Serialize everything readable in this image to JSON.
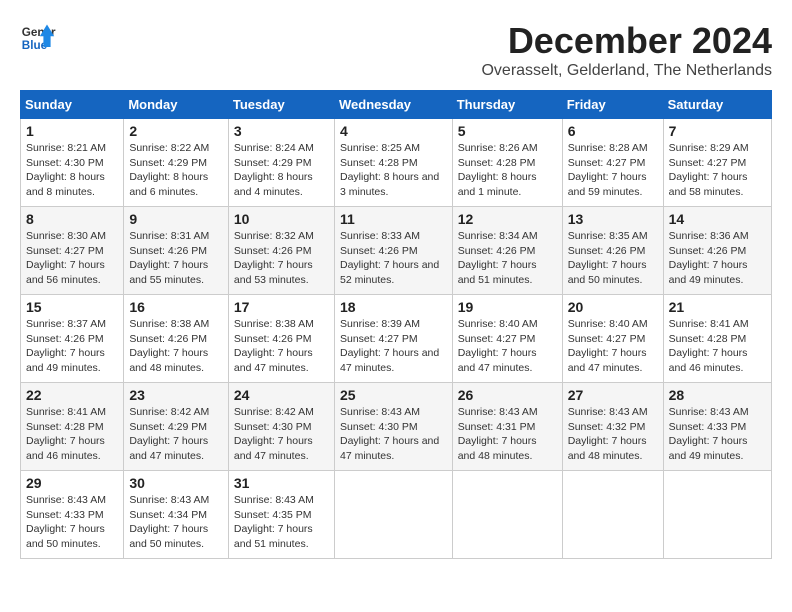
{
  "header": {
    "logo_line1": "General",
    "logo_line2": "Blue",
    "month": "December 2024",
    "location": "Overasselt, Gelderland, The Netherlands"
  },
  "days_of_week": [
    "Sunday",
    "Monday",
    "Tuesday",
    "Wednesday",
    "Thursday",
    "Friday",
    "Saturday"
  ],
  "weeks": [
    [
      {
        "day": "1",
        "sunrise": "8:21 AM",
        "sunset": "4:30 PM",
        "daylight": "8 hours and 8 minutes."
      },
      {
        "day": "2",
        "sunrise": "8:22 AM",
        "sunset": "4:29 PM",
        "daylight": "8 hours and 6 minutes."
      },
      {
        "day": "3",
        "sunrise": "8:24 AM",
        "sunset": "4:29 PM",
        "daylight": "8 hours and 4 minutes."
      },
      {
        "day": "4",
        "sunrise": "8:25 AM",
        "sunset": "4:28 PM",
        "daylight": "8 hours and 3 minutes."
      },
      {
        "day": "5",
        "sunrise": "8:26 AM",
        "sunset": "4:28 PM",
        "daylight": "8 hours and 1 minute."
      },
      {
        "day": "6",
        "sunrise": "8:28 AM",
        "sunset": "4:27 PM",
        "daylight": "7 hours and 59 minutes."
      },
      {
        "day": "7",
        "sunrise": "8:29 AM",
        "sunset": "4:27 PM",
        "daylight": "7 hours and 58 minutes."
      }
    ],
    [
      {
        "day": "8",
        "sunrise": "8:30 AM",
        "sunset": "4:27 PM",
        "daylight": "7 hours and 56 minutes."
      },
      {
        "day": "9",
        "sunrise": "8:31 AM",
        "sunset": "4:26 PM",
        "daylight": "7 hours and 55 minutes."
      },
      {
        "day": "10",
        "sunrise": "8:32 AM",
        "sunset": "4:26 PM",
        "daylight": "7 hours and 53 minutes."
      },
      {
        "day": "11",
        "sunrise": "8:33 AM",
        "sunset": "4:26 PM",
        "daylight": "7 hours and 52 minutes."
      },
      {
        "day": "12",
        "sunrise": "8:34 AM",
        "sunset": "4:26 PM",
        "daylight": "7 hours and 51 minutes."
      },
      {
        "day": "13",
        "sunrise": "8:35 AM",
        "sunset": "4:26 PM",
        "daylight": "7 hours and 50 minutes."
      },
      {
        "day": "14",
        "sunrise": "8:36 AM",
        "sunset": "4:26 PM",
        "daylight": "7 hours and 49 minutes."
      }
    ],
    [
      {
        "day": "15",
        "sunrise": "8:37 AM",
        "sunset": "4:26 PM",
        "daylight": "7 hours and 49 minutes."
      },
      {
        "day": "16",
        "sunrise": "8:38 AM",
        "sunset": "4:26 PM",
        "daylight": "7 hours and 48 minutes."
      },
      {
        "day": "17",
        "sunrise": "8:38 AM",
        "sunset": "4:26 PM",
        "daylight": "7 hours and 47 minutes."
      },
      {
        "day": "18",
        "sunrise": "8:39 AM",
        "sunset": "4:27 PM",
        "daylight": "7 hours and 47 minutes."
      },
      {
        "day": "19",
        "sunrise": "8:40 AM",
        "sunset": "4:27 PM",
        "daylight": "7 hours and 47 minutes."
      },
      {
        "day": "20",
        "sunrise": "8:40 AM",
        "sunset": "4:27 PM",
        "daylight": "7 hours and 47 minutes."
      },
      {
        "day": "21",
        "sunrise": "8:41 AM",
        "sunset": "4:28 PM",
        "daylight": "7 hours and 46 minutes."
      }
    ],
    [
      {
        "day": "22",
        "sunrise": "8:41 AM",
        "sunset": "4:28 PM",
        "daylight": "7 hours and 46 minutes."
      },
      {
        "day": "23",
        "sunrise": "8:42 AM",
        "sunset": "4:29 PM",
        "daylight": "7 hours and 47 minutes."
      },
      {
        "day": "24",
        "sunrise": "8:42 AM",
        "sunset": "4:30 PM",
        "daylight": "7 hours and 47 minutes."
      },
      {
        "day": "25",
        "sunrise": "8:43 AM",
        "sunset": "4:30 PM",
        "daylight": "7 hours and 47 minutes."
      },
      {
        "day": "26",
        "sunrise": "8:43 AM",
        "sunset": "4:31 PM",
        "daylight": "7 hours and 48 minutes."
      },
      {
        "day": "27",
        "sunrise": "8:43 AM",
        "sunset": "4:32 PM",
        "daylight": "7 hours and 48 minutes."
      },
      {
        "day": "28",
        "sunrise": "8:43 AM",
        "sunset": "4:33 PM",
        "daylight": "7 hours and 49 minutes."
      }
    ],
    [
      {
        "day": "29",
        "sunrise": "8:43 AM",
        "sunset": "4:33 PM",
        "daylight": "7 hours and 50 minutes."
      },
      {
        "day": "30",
        "sunrise": "8:43 AM",
        "sunset": "4:34 PM",
        "daylight": "7 hours and 50 minutes."
      },
      {
        "day": "31",
        "sunrise": "8:43 AM",
        "sunset": "4:35 PM",
        "daylight": "7 hours and 51 minutes."
      },
      null,
      null,
      null,
      null
    ]
  ],
  "labels": {
    "sunrise": "Sunrise:",
    "sunset": "Sunset:",
    "daylight": "Daylight:"
  }
}
